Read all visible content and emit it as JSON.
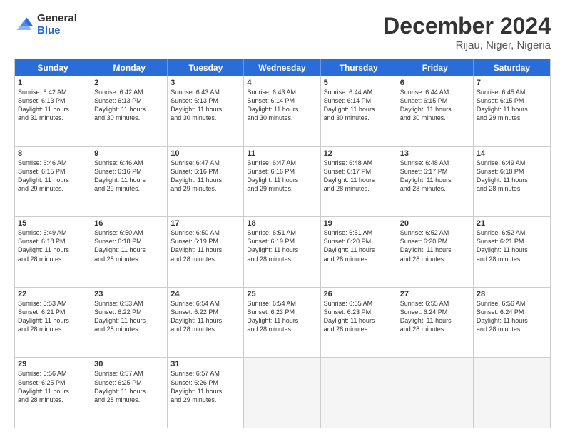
{
  "logo": {
    "general": "General",
    "blue": "Blue"
  },
  "title": "December 2024",
  "subtitle": "Rijau, Niger, Nigeria",
  "weekdays": [
    "Sunday",
    "Monday",
    "Tuesday",
    "Wednesday",
    "Thursday",
    "Friday",
    "Saturday"
  ],
  "weeks": [
    [
      {
        "day": "1",
        "info": "Sunrise: 6:42 AM\nSunset: 6:13 PM\nDaylight: 11 hours\nand 31 minutes."
      },
      {
        "day": "2",
        "info": "Sunrise: 6:42 AM\nSunset: 6:13 PM\nDaylight: 11 hours\nand 30 minutes."
      },
      {
        "day": "3",
        "info": "Sunrise: 6:43 AM\nSunset: 6:13 PM\nDaylight: 11 hours\nand 30 minutes."
      },
      {
        "day": "4",
        "info": "Sunrise: 6:43 AM\nSunset: 6:14 PM\nDaylight: 11 hours\nand 30 minutes."
      },
      {
        "day": "5",
        "info": "Sunrise: 6:44 AM\nSunset: 6:14 PM\nDaylight: 11 hours\nand 30 minutes."
      },
      {
        "day": "6",
        "info": "Sunrise: 6:44 AM\nSunset: 6:15 PM\nDaylight: 11 hours\nand 30 minutes."
      },
      {
        "day": "7",
        "info": "Sunrise: 6:45 AM\nSunset: 6:15 PM\nDaylight: 11 hours\nand 29 minutes."
      }
    ],
    [
      {
        "day": "8",
        "info": "Sunrise: 6:46 AM\nSunset: 6:15 PM\nDaylight: 11 hours\nand 29 minutes."
      },
      {
        "day": "9",
        "info": "Sunrise: 6:46 AM\nSunset: 6:16 PM\nDaylight: 11 hours\nand 29 minutes."
      },
      {
        "day": "10",
        "info": "Sunrise: 6:47 AM\nSunset: 6:16 PM\nDaylight: 11 hours\nand 29 minutes."
      },
      {
        "day": "11",
        "info": "Sunrise: 6:47 AM\nSunset: 6:16 PM\nDaylight: 11 hours\nand 29 minutes."
      },
      {
        "day": "12",
        "info": "Sunrise: 6:48 AM\nSunset: 6:17 PM\nDaylight: 11 hours\nand 28 minutes."
      },
      {
        "day": "13",
        "info": "Sunrise: 6:48 AM\nSunset: 6:17 PM\nDaylight: 11 hours\nand 28 minutes."
      },
      {
        "day": "14",
        "info": "Sunrise: 6:49 AM\nSunset: 6:18 PM\nDaylight: 11 hours\nand 28 minutes."
      }
    ],
    [
      {
        "day": "15",
        "info": "Sunrise: 6:49 AM\nSunset: 6:18 PM\nDaylight: 11 hours\nand 28 minutes."
      },
      {
        "day": "16",
        "info": "Sunrise: 6:50 AM\nSunset: 6:18 PM\nDaylight: 11 hours\nand 28 minutes."
      },
      {
        "day": "17",
        "info": "Sunrise: 6:50 AM\nSunset: 6:19 PM\nDaylight: 11 hours\nand 28 minutes."
      },
      {
        "day": "18",
        "info": "Sunrise: 6:51 AM\nSunset: 6:19 PM\nDaylight: 11 hours\nand 28 minutes."
      },
      {
        "day": "19",
        "info": "Sunrise: 6:51 AM\nSunset: 6:20 PM\nDaylight: 11 hours\nand 28 minutes."
      },
      {
        "day": "20",
        "info": "Sunrise: 6:52 AM\nSunset: 6:20 PM\nDaylight: 11 hours\nand 28 minutes."
      },
      {
        "day": "21",
        "info": "Sunrise: 6:52 AM\nSunset: 6:21 PM\nDaylight: 11 hours\nand 28 minutes."
      }
    ],
    [
      {
        "day": "22",
        "info": "Sunrise: 6:53 AM\nSunset: 6:21 PM\nDaylight: 11 hours\nand 28 minutes."
      },
      {
        "day": "23",
        "info": "Sunrise: 6:53 AM\nSunset: 6:22 PM\nDaylight: 11 hours\nand 28 minutes."
      },
      {
        "day": "24",
        "info": "Sunrise: 6:54 AM\nSunset: 6:22 PM\nDaylight: 11 hours\nand 28 minutes."
      },
      {
        "day": "25",
        "info": "Sunrise: 6:54 AM\nSunset: 6:23 PM\nDaylight: 11 hours\nand 28 minutes."
      },
      {
        "day": "26",
        "info": "Sunrise: 6:55 AM\nSunset: 6:23 PM\nDaylight: 11 hours\nand 28 minutes."
      },
      {
        "day": "27",
        "info": "Sunrise: 6:55 AM\nSunset: 6:24 PM\nDaylight: 11 hours\nand 28 minutes."
      },
      {
        "day": "28",
        "info": "Sunrise: 6:56 AM\nSunset: 6:24 PM\nDaylight: 11 hours\nand 28 minutes."
      }
    ],
    [
      {
        "day": "29",
        "info": "Sunrise: 6:56 AM\nSunset: 6:25 PM\nDaylight: 11 hours\nand 28 minutes."
      },
      {
        "day": "30",
        "info": "Sunrise: 6:57 AM\nSunset: 6:25 PM\nDaylight: 11 hours\nand 28 minutes."
      },
      {
        "day": "31",
        "info": "Sunrise: 6:57 AM\nSunset: 6:26 PM\nDaylight: 11 hours\nand 29 minutes."
      },
      {
        "day": "",
        "info": ""
      },
      {
        "day": "",
        "info": ""
      },
      {
        "day": "",
        "info": ""
      },
      {
        "day": "",
        "info": ""
      }
    ]
  ]
}
